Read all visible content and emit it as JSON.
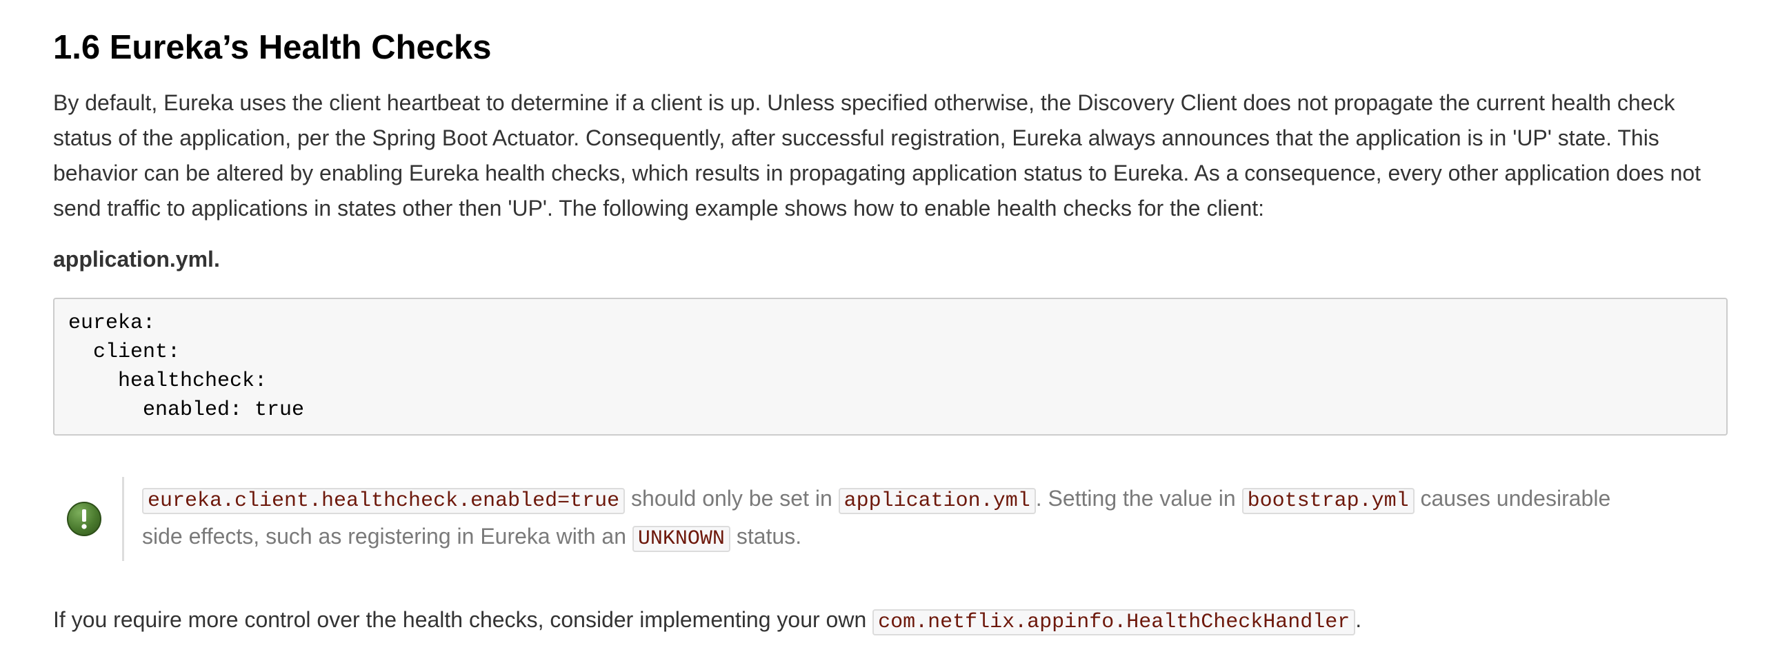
{
  "section": {
    "title": "1.6 Eureka’s Health Checks"
  },
  "intro": {
    "text": "By default, Eureka uses the client heartbeat to determine if a client is up. Unless specified otherwise, the Discovery Client does not propagate the current health check status of the application, per the Spring Boot Actuator. Consequently, after successful registration, Eureka always announces that the application is in 'UP' state. This behavior can be altered by enabling Eureka health checks, which results in propagating application status to Eureka. As a consequence, every other application does not send traffic to applications in states other then 'UP'. The following example shows how to enable health checks for the client:"
  },
  "listing": {
    "title": "application.yml.",
    "code_lines": [
      "eureka:",
      "  client:",
      "    healthcheck:",
      "      enabled: true"
    ]
  },
  "admonition": {
    "icon": "exclamation-icon",
    "icon_color": "#4a7a2e",
    "code_property": "eureka.client.healthcheck.enabled=true",
    "text_1": " should only be set in ",
    "code_app_yml": "application.yml",
    "text_2": ". Setting the value in ",
    "code_bootstrap_yml": "bootstrap.yml",
    "text_3": " causes undesirable side effects, such as registering in Eureka with an ",
    "code_unknown": "UNKNOWN",
    "text_4": " status."
  },
  "outro": {
    "text_1": "If you require more control over the health checks, consider implementing your own ",
    "code_handler": "com.netflix.appinfo.HealthCheckHandler",
    "text_2": "."
  },
  "colors": {
    "code_text": "#6d180b",
    "code_background": "#f7f7f7",
    "admonition_text": "#7a7a7a"
  }
}
